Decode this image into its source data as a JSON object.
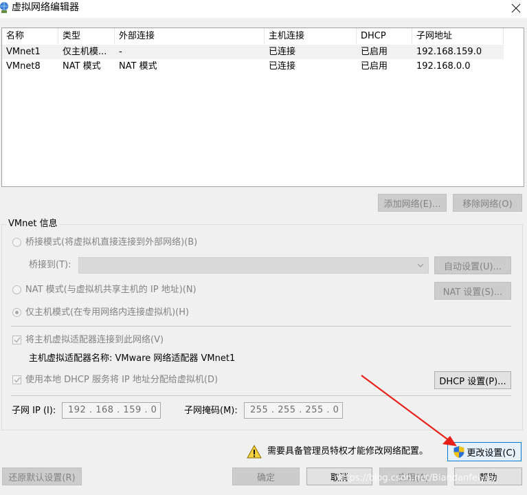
{
  "window": {
    "title": "虚拟网络编辑器"
  },
  "table": {
    "headers": [
      "名称",
      "类型",
      "外部连接",
      "主机连接",
      "DHCP",
      "子网地址"
    ],
    "rows": [
      [
        "VMnet1",
        "仅主机模...",
        "-",
        "已连接",
        "已启用",
        "192.168.159.0"
      ],
      [
        "VMnet8",
        "NAT 模式",
        "NAT 模式",
        "已连接",
        "已启用",
        "192.168.0.0"
      ]
    ]
  },
  "list_buttons": {
    "add": "添加网络(E)...",
    "remove": "移除网络(O)"
  },
  "vmnet_info": {
    "label": "VMnet 信息",
    "bridge_radio": "桥接模式(将虚拟机直接连接到外部网络)(B)",
    "bridge_to_label": "桥接到(T):",
    "auto_settings": "自动设置(U)...",
    "nat_radio": "NAT 模式(与虚拟机共享主机的 IP 地址)(N)",
    "nat_settings": "NAT 设置(S)...",
    "hostonly_radio": "仅主机模式(在专用网络内连接虚拟机)(H)",
    "connect_adapter_check": "将主机虚拟适配器连接到此网络(V)",
    "adapter_name": "主机虚拟适配器名称: VMware 网络适配器 VMnet1",
    "dhcp_check": "使用本地 DHCP 服务将 IP 地址分配给虚拟机(D)",
    "dhcp_settings": "DHCP 设置(P)...",
    "subnet_ip_label": "子网 IP (I):",
    "subnet_ip_value": "192 . 168 . 159 .  0",
    "subnet_mask_label": "子网掩码(M):",
    "subnet_mask_value": "255 . 255 . 255 .  0"
  },
  "admin_notice": "需要具备管理员特权才能修改网络配置。",
  "change_settings": "更改设置(C)",
  "bottom_buttons": {
    "restore": "还原默认设置(R)",
    "ok": "确定",
    "cancel": "取消",
    "apply": "应用(A)",
    "help": "帮助"
  },
  "watermark": "https://blog.csdn.net/Biandanfeiyou",
  "colors": {
    "annotation_arrow": "#e8201a",
    "shield_blue": "#2a6fd6",
    "shield_yellow": "#f2c21b",
    "warning_yellow": "#f7d23e"
  }
}
